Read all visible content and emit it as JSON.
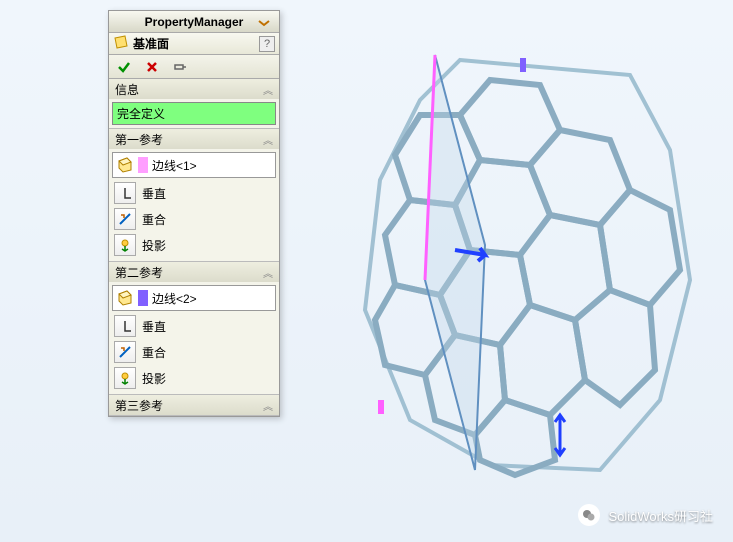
{
  "panel": {
    "title": "PropertyManager",
    "feature_name": "基准面",
    "help": "?"
  },
  "actions": {
    "ok": "✓",
    "cancel": "✗",
    "pushpin": "⊣"
  },
  "sections": {
    "info": {
      "title": "信息",
      "status": "完全定义"
    },
    "ref1": {
      "title": "第一参考",
      "selection": "边线<1>",
      "options": {
        "perpendicular": "垂直",
        "coincident": "重合",
        "project": "投影"
      }
    },
    "ref2": {
      "title": "第二参考",
      "selection": "边线<2>",
      "options": {
        "perpendicular": "垂直",
        "coincident": "重合",
        "project": "投影"
      }
    },
    "ref3": {
      "title": "第三参考"
    }
  },
  "watermark": {
    "text": "SolidWorks研习社"
  }
}
